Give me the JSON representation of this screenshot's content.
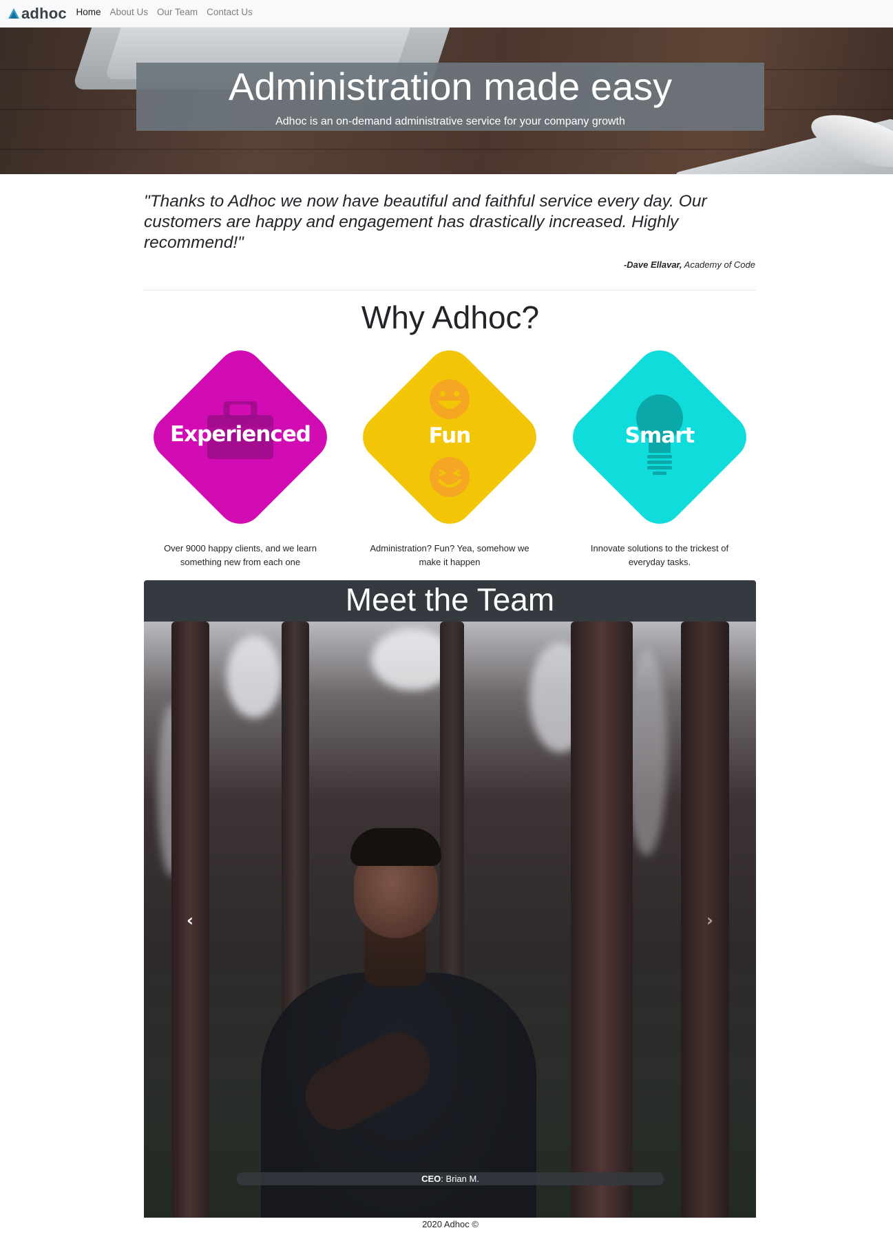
{
  "navbar": {
    "brand": "adhoc",
    "links": [
      {
        "label": "Home",
        "active": true
      },
      {
        "label": "About Us",
        "active": false
      },
      {
        "label": "Our Team",
        "active": false
      },
      {
        "label": "Contact Us",
        "active": false
      }
    ]
  },
  "hero": {
    "title": "Administration made easy",
    "subtitle": "Adhoc is an on-demand administrative service for your company growth"
  },
  "testimonial": {
    "quote": "\"Thanks to Adhoc we now have beautiful and faithful service every day. Our customers are happy and engagement has drastically increased. Highly recommend!\"",
    "author": "-Dave Ellavar,",
    "company": "Academy of Code"
  },
  "why": {
    "title": "Why Adhoc?",
    "features": [
      {
        "label": "Experienced",
        "color": "#d20cb3",
        "icon": "briefcase-icon",
        "description": "Over 9000 happy clients, and we learn something new from each one"
      },
      {
        "label": "Fun",
        "color": "#f2c607",
        "icon": "smiley-icon",
        "description": "Administration? Fun? Yea, somehow we make it happen"
      },
      {
        "label": "Smart",
        "color": "#10dcdc",
        "icon": "lightbulb-icon",
        "description": "Innovate solutions to the trickest of everyday tasks."
      }
    ]
  },
  "team": {
    "title": "Meet the Team",
    "caption_role": "CEO",
    "caption_name": ": Brian M.",
    "prev_icon": "chevron-left-icon",
    "next_icon": "chevron-right-icon"
  },
  "footer": {
    "text": "2020 Adhoc ©"
  }
}
